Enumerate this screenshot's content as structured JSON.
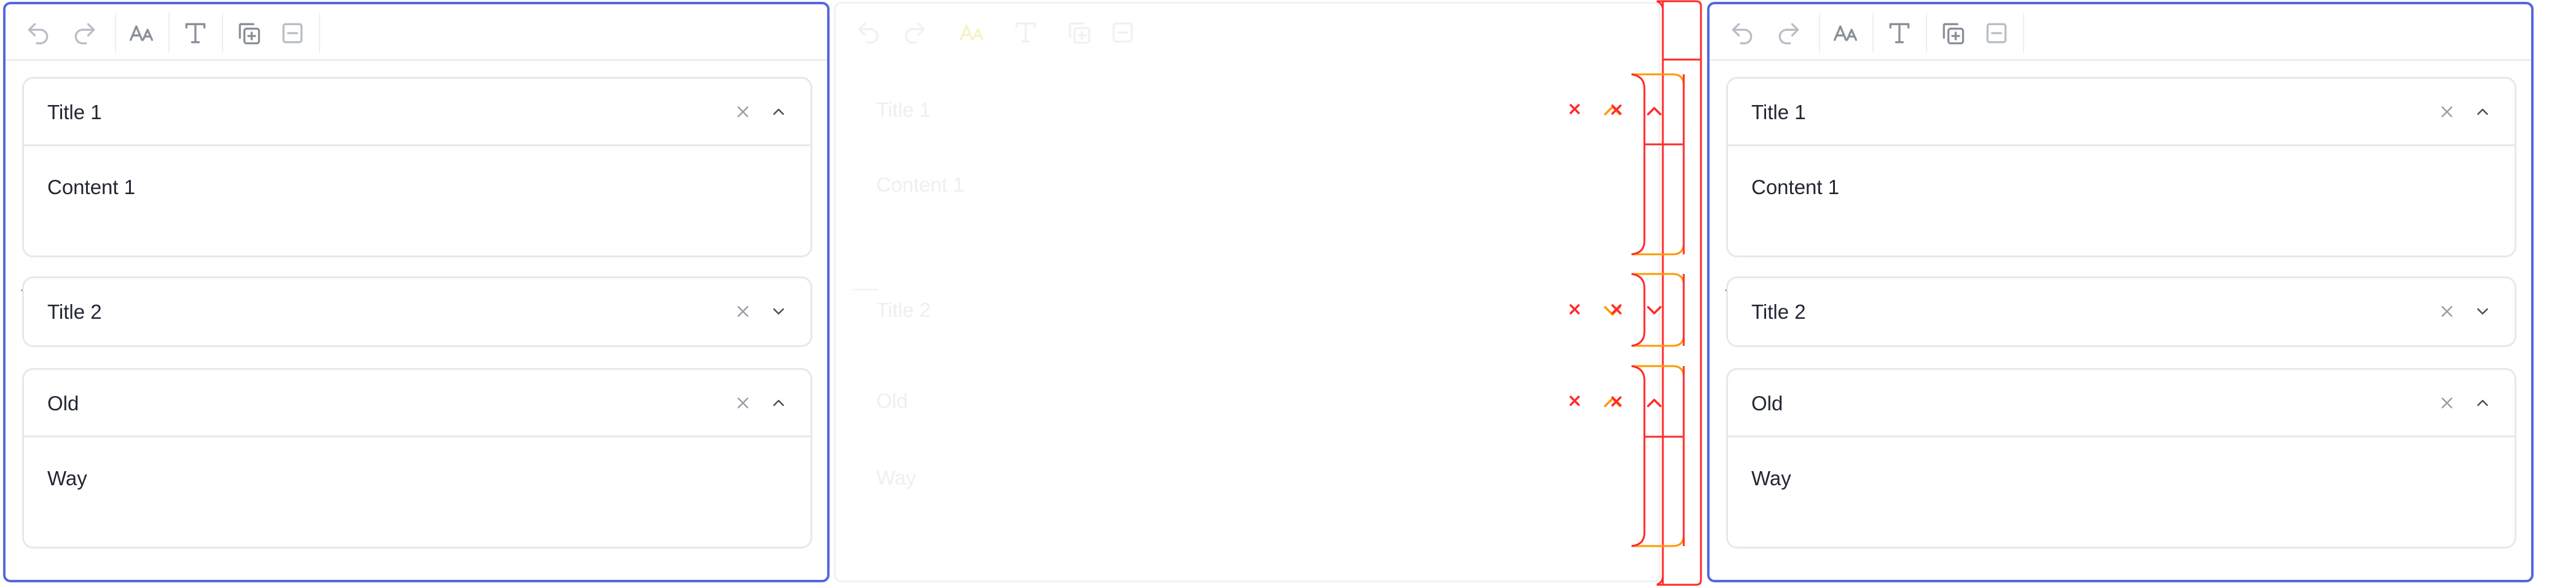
{
  "panels": [
    {
      "id": "editor-left",
      "toolbar": [
        "undo-icon",
        "redo-icon",
        "font-size-icon",
        "text-format-icon",
        "add-copy-icon",
        "remove-icon"
      ],
      "sections": [
        {
          "title": "Title 1",
          "content": "Content 1",
          "expanded": true
        },
        {
          "title": "Title 2",
          "content": "",
          "expanded": false
        },
        {
          "title": "Old",
          "content": "Way",
          "expanded": true
        }
      ]
    },
    {
      "id": "editor-middle-faded",
      "sections": [
        {
          "title": "Title 1",
          "content": "Content 1"
        },
        {
          "title": "Title 2",
          "content": ""
        },
        {
          "title": "Old",
          "content": "Way"
        }
      ]
    },
    {
      "id": "editor-right",
      "sections": [
        {
          "title": "Title 1",
          "content": "Content 1",
          "expanded": true
        },
        {
          "title": "Title 2",
          "content": "",
          "expanded": false
        },
        {
          "title": "Old",
          "content": "Way",
          "expanded": true
        }
      ]
    }
  ],
  "colors": {
    "panel_border": "#5468dd",
    "section_border": "#e6e8ec",
    "overlay_red": "#ff2a2a",
    "overlay_orange": "#ff9900",
    "text": "#222633"
  }
}
